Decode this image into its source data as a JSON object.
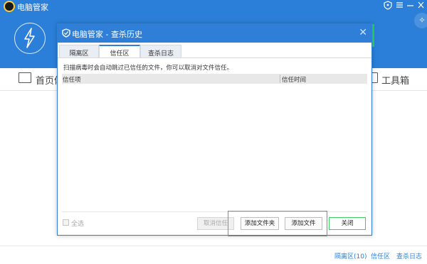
{
  "app": {
    "title": "电脑管家",
    "window_controls": [
      "shield-icon",
      "menu-icon",
      "minimize-icon",
      "close-icon"
    ],
    "nav": {
      "home_label": "首页体",
      "toolbox_label": "工具箱"
    },
    "footer": {
      "quarantine_link": "隔离区(10)",
      "trust_link": "信任区",
      "log_link": "查杀日志"
    }
  },
  "dialog": {
    "title": "电脑管家 - 查杀历史",
    "tabs": [
      {
        "label": "隔离区",
        "active": false
      },
      {
        "label": "信任区",
        "active": true
      },
      {
        "label": "查杀日志",
        "active": false
      }
    ],
    "description": "扫描病毒时会自动跳过已信任的文件，你可以取消对文件信任。",
    "table": {
      "columns": [
        "信任项",
        "信任时间"
      ],
      "rows": []
    },
    "select_all_label": "全选",
    "buttons": {
      "cancel_trust": "取消信任",
      "add_folder": "添加文件夹",
      "add_file": "添加文件",
      "close": "关闭"
    }
  },
  "colors": {
    "header_blue": "#2b7fd9",
    "dialog_blue": "#2f7ed7",
    "accent_green": "#2bd45c"
  }
}
